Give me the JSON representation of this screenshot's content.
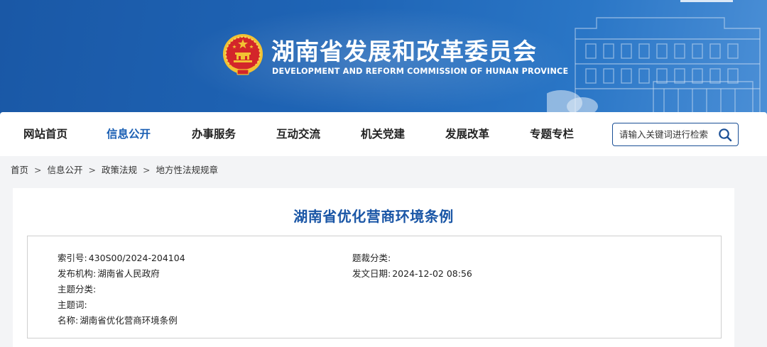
{
  "header": {
    "title": "湖南省发展和改革委员会",
    "subtitle": "DEVELOPMENT AND REFORM COMMISSION OF HUNAN PROVINCE"
  },
  "nav": {
    "items": [
      {
        "label": "网站首页",
        "active": false
      },
      {
        "label": "信息公开",
        "active": true
      },
      {
        "label": "办事服务",
        "active": false
      },
      {
        "label": "互动交流",
        "active": false
      },
      {
        "label": "机关党建",
        "active": false
      },
      {
        "label": "发展改革",
        "active": false
      },
      {
        "label": "专题专栏",
        "active": false
      }
    ],
    "search_placeholder": "请输入关键词进行检索"
  },
  "breadcrumb": {
    "items": [
      "首页",
      "信息公开",
      "政策法规",
      "地方性法规规章"
    ],
    "separator": ">"
  },
  "article": {
    "title": "湖南省优化营商环境条例",
    "meta": {
      "index_label": "索引号:",
      "index_value": "430S00/2024-204104",
      "publisher_label": "发布机构:",
      "publisher_value": "湖南省人民政府",
      "topic_label": "主题分类:",
      "topic_value": "",
      "keywords_label": "主题词:",
      "keywords_value": "",
      "name_label": "名称:",
      "name_value": "湖南省优化营商环境条例",
      "genre_label": "题裁分类:",
      "genre_value": "",
      "date_label": "发文日期:",
      "date_value": "2024-12-02 08:56"
    }
  },
  "colors": {
    "banner": "#1f65b6",
    "nav_active": "#1a5fb4",
    "title": "#1a56a6",
    "emblem_red": "#d3262a",
    "emblem_gold": "#f2c233"
  },
  "icons": {
    "emblem": "national-emblem-icon",
    "search": "search-icon"
  }
}
